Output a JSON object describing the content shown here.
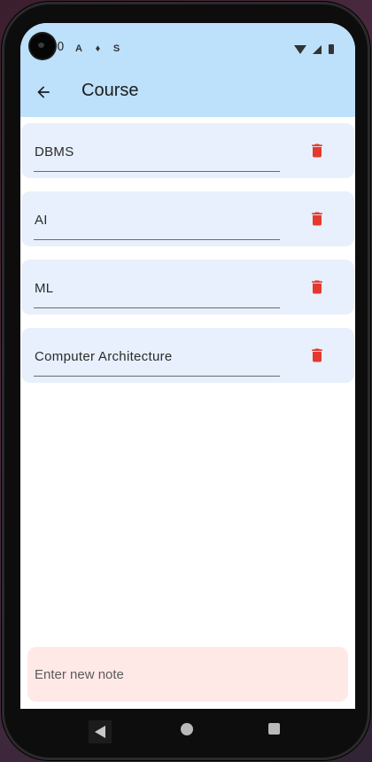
{
  "status_bar": {
    "time": "50",
    "notification_icons": [
      "A",
      "♦",
      "S"
    ],
    "right_icons": [
      "wifi-icon",
      "signal-icon",
      "battery-icon"
    ]
  },
  "app_bar": {
    "title": "Course",
    "back_icon": "arrow-left-icon",
    "background": "#bde0fb"
  },
  "courses": [
    {
      "name": "DBMS"
    },
    {
      "name": "AI"
    },
    {
      "name": "ML"
    },
    {
      "name": "Computer Architecture"
    }
  ],
  "delete_icon": "trash-icon",
  "delete_color": "#e5392f",
  "item_background": "#e7f0fc",
  "new_note": {
    "placeholder": "Enter new note",
    "value": ""
  },
  "nav_bar": [
    "back-triangle-icon",
    "home-circle-icon",
    "recents-square-icon"
  ]
}
